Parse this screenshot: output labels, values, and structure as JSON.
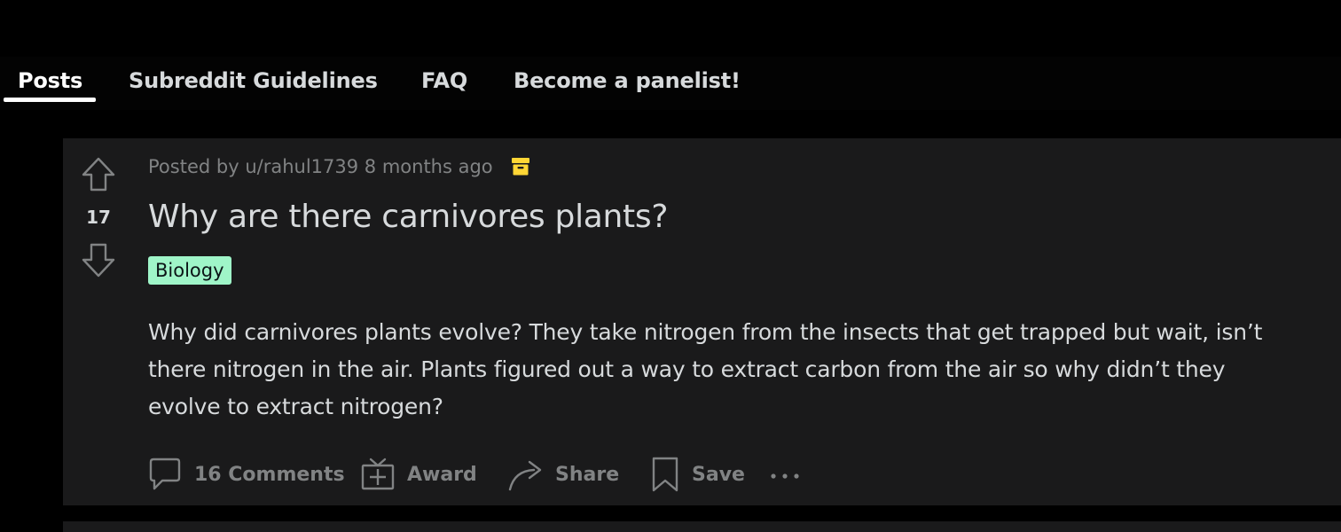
{
  "tabs": [
    {
      "label": "Posts",
      "active": true
    },
    {
      "label": "Subreddit Guidelines",
      "active": false
    },
    {
      "label": "FAQ",
      "active": false
    },
    {
      "label": "Become a panelist!",
      "active": false
    }
  ],
  "post": {
    "score": "17",
    "meta": {
      "prefix": "Posted by",
      "user": "u/rahul1739",
      "time": "8 months ago",
      "archived_icon": "archive-icon"
    },
    "title": "Why are there carnivores plants?",
    "flair": {
      "label": "Biology",
      "color": "#9ff5c8"
    },
    "body_lines": [
      "Why did carnivores plants evolve? They take nitrogen from the insects that get trapped but wait, isn’t",
      "there nitrogen in the air. Plants figured out a way to extract carbon from the air so why didn’t they",
      "evolve to extract nitrogen?"
    ],
    "actions": {
      "comments": "16 Comments",
      "award": "Award",
      "share": "Share",
      "save": "Save"
    }
  },
  "colors": {
    "background": "#000000",
    "card": "#1a1a1b",
    "text": "#d7dadc",
    "muted": "#818384",
    "archive_accent": "#ffd635"
  }
}
